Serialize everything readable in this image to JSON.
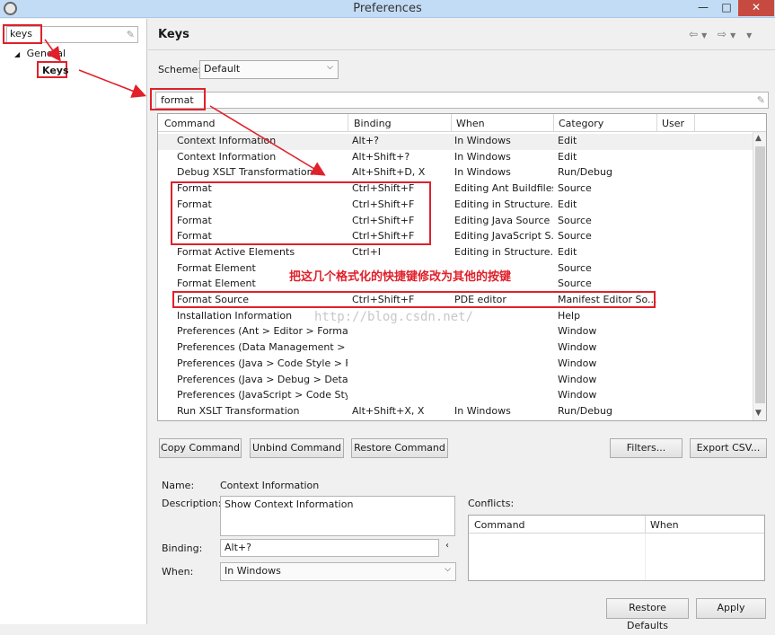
{
  "window": {
    "title": "Preferences"
  },
  "left": {
    "filter_value": "keys",
    "tree_general": "General",
    "tree_keys": "Keys"
  },
  "page": {
    "title": "Keys"
  },
  "scheme": {
    "label": "Scheme:",
    "value": "Default"
  },
  "filter": {
    "value": "format"
  },
  "table": {
    "headers": [
      "Command",
      "Binding",
      "When",
      "Category",
      "User"
    ],
    "rows": [
      [
        "Context Information",
        "Alt+?",
        "In Windows",
        "Edit"
      ],
      [
        "Context Information",
        "Alt+Shift+?",
        "In Windows",
        "Edit"
      ],
      [
        "Debug XSLT Transformation",
        "Alt+Shift+D, X",
        "In Windows",
        "Run/Debug"
      ],
      [
        "Format",
        "Ctrl+Shift+F",
        "Editing Ant Buildfiles",
        "Source"
      ],
      [
        "Format",
        "Ctrl+Shift+F",
        "Editing in Structure...",
        "Edit"
      ],
      [
        "Format",
        "Ctrl+Shift+F",
        "Editing Java Source",
        "Source"
      ],
      [
        "Format",
        "Ctrl+Shift+F",
        "Editing JavaScript S...",
        "Source"
      ],
      [
        "Format Active Elements",
        "Ctrl+I",
        "Editing in Structure...",
        "Edit"
      ],
      [
        "Format Element",
        "",
        "",
        "Source"
      ],
      [
        "Format Element",
        "",
        "",
        "Source"
      ],
      [
        "Format Source",
        "Ctrl+Shift+F",
        "PDE editor",
        "Manifest Editor So..."
      ],
      [
        "Installation Information",
        "",
        "",
        "Help"
      ],
      [
        "Preferences (Ant > Editor > Formatte",
        "",
        "",
        "Window"
      ],
      [
        "Preferences (Data Management > SQ",
        "",
        "",
        "Window"
      ],
      [
        "Preferences (Java > Code Style > For",
        "",
        "",
        "Window"
      ],
      [
        "Preferences (Java > Debug > Detail F",
        "",
        "",
        "Window"
      ],
      [
        "Preferences (JavaScript > Code Style",
        "",
        "",
        "Window"
      ],
      [
        "Run XSLT Transformation",
        "Alt+Shift+X, X",
        "In Windows",
        "Run/Debug"
      ]
    ]
  },
  "buttons": {
    "copy": "Copy Command",
    "unbind": "Unbind Command",
    "restore": "Restore Command",
    "filters": "Filters...",
    "export": "Export CSV...",
    "restore_defaults": "Restore Defaults",
    "apply": "Apply"
  },
  "details": {
    "name_label": "Name:",
    "name_value": "Context Information",
    "description_label": "Description:",
    "description_value": "Show Context Information",
    "binding_label": "Binding:",
    "binding_value": "Alt+?",
    "when_label": "When:",
    "when_value": "In Windows",
    "conflicts_label": "Conflicts:",
    "conflicts_headers": [
      "Command",
      "When"
    ]
  },
  "annotation": {
    "text": "把这几个格式化的快捷键修改为其他的按键",
    "watermark": "http://blog.csdn.net/"
  },
  "colors": {
    "annotation_red": "#e0202a",
    "titlebar": "#c3dcf5"
  }
}
